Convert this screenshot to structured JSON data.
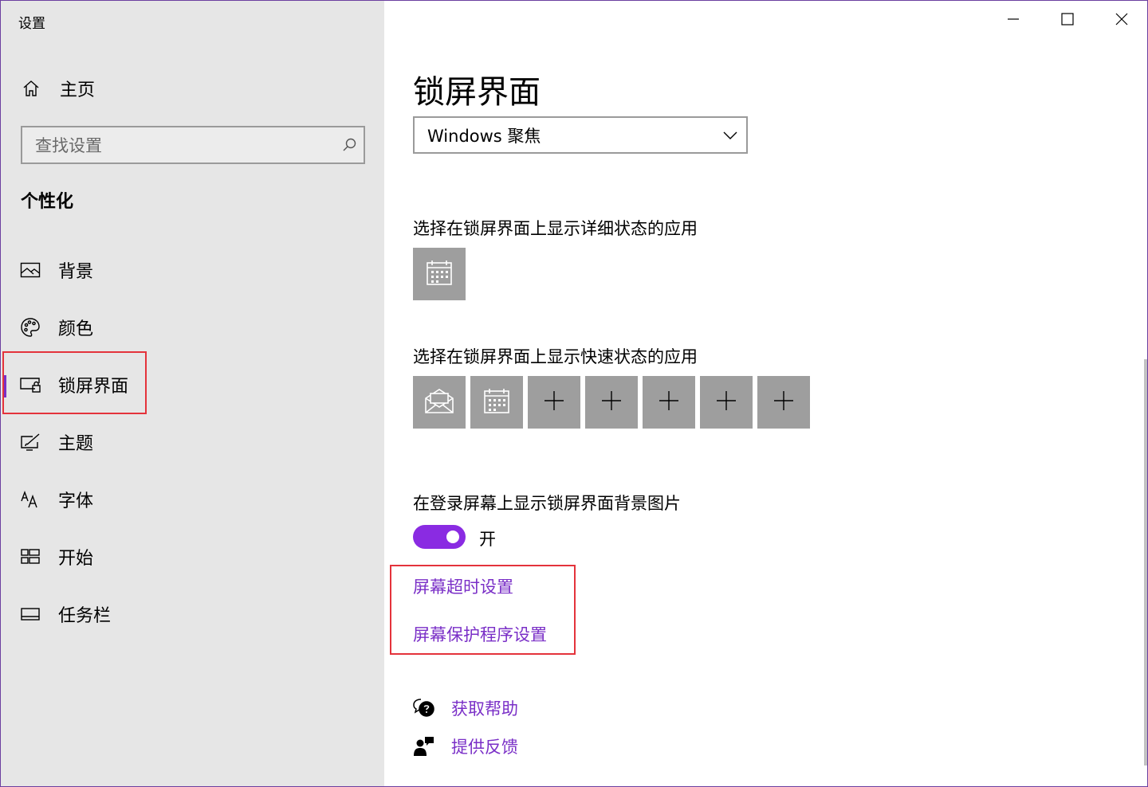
{
  "window": {
    "title": "设置",
    "controls": [
      "minimize-icon",
      "maximize-icon",
      "close-icon"
    ]
  },
  "sidebar": {
    "home_label": "主页",
    "search_placeholder": "查找设置",
    "section_title": "个性化",
    "items": [
      {
        "label": "背景",
        "icon": "picture-icon"
      },
      {
        "label": "颜色",
        "icon": "palette-icon"
      },
      {
        "label": "锁屏界面",
        "icon": "lock-screen-icon",
        "selected": true
      },
      {
        "label": "主题",
        "icon": "theme-icon"
      },
      {
        "label": "字体",
        "icon": "font-icon"
      },
      {
        "label": "开始",
        "icon": "start-icon"
      },
      {
        "label": "任务栏",
        "icon": "taskbar-icon"
      }
    ]
  },
  "main": {
    "title": "锁屏界面",
    "background_select": "Windows 聚焦",
    "detailed_status_label": "选择在锁屏界面上显示详细状态的应用",
    "detailed_status_apps": [
      "calendar-icon"
    ],
    "quick_status_label": "选择在锁屏界面上显示快速状态的应用",
    "quick_status_apps": [
      "mail-icon",
      "calendar-icon",
      "plus-icon",
      "plus-icon",
      "plus-icon",
      "plus-icon",
      "plus-icon"
    ],
    "signin_bg_label": "在登录屏幕上显示锁屏界面背景图片",
    "signin_bg_toggle": {
      "state": "开",
      "on": true
    },
    "links": {
      "screen_timeout": "屏幕超时设置",
      "screen_saver": "屏幕保护程序设置",
      "get_help": "获取帮助",
      "give_feedback": "提供反馈"
    }
  },
  "colors": {
    "accent": "#7a2fc7",
    "highlight_box": "#e4333b",
    "sidebar_bg": "#e6e6e6",
    "tile_bg": "#9e9e9e"
  }
}
